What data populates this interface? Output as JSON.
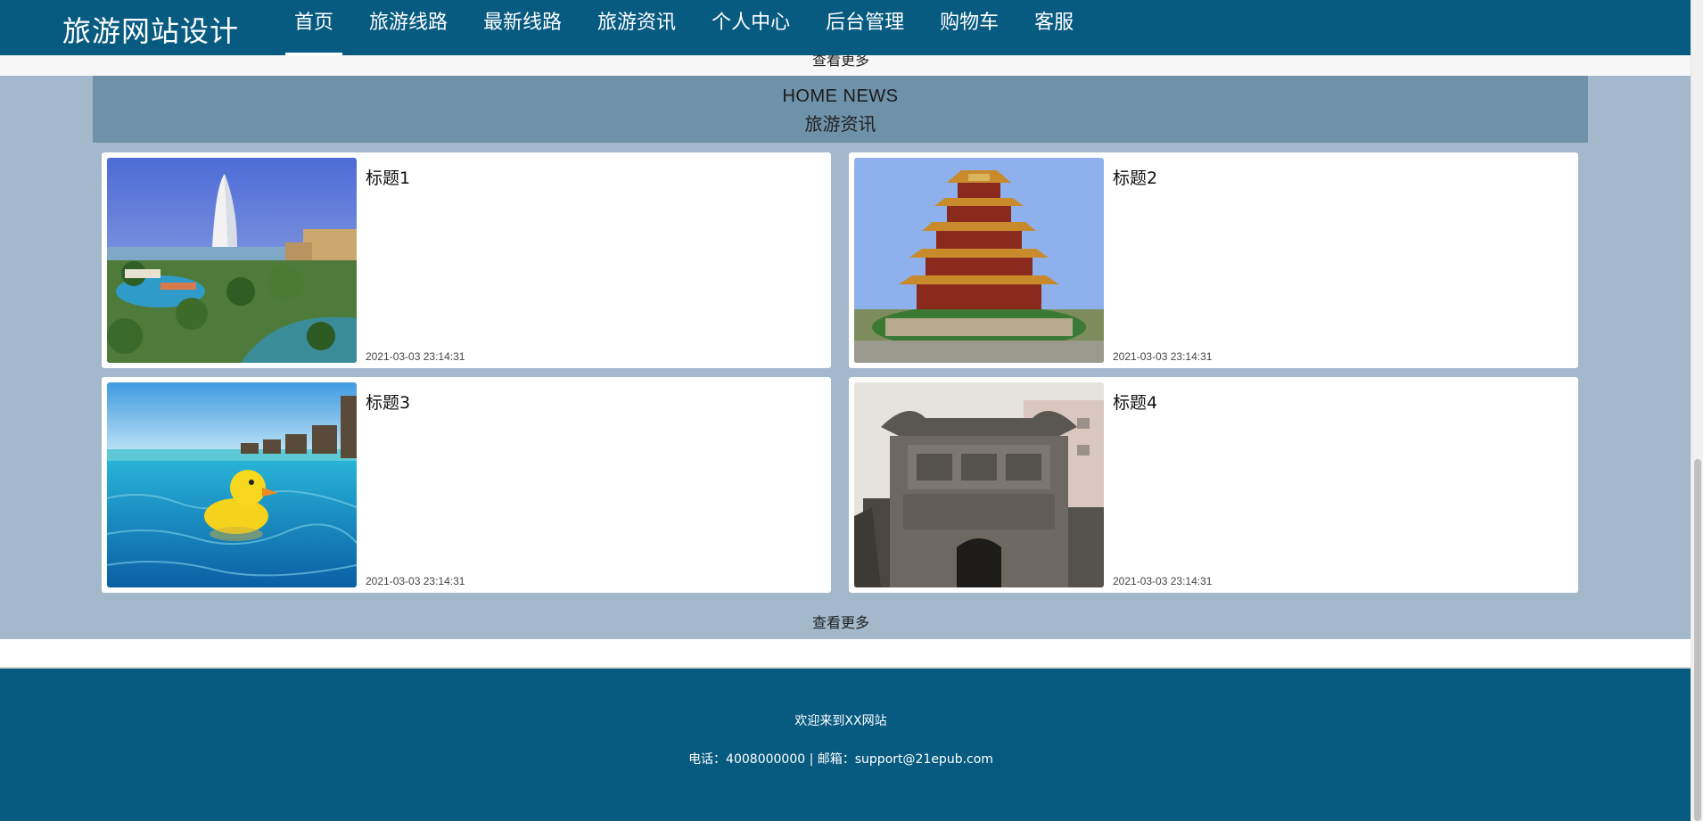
{
  "header": {
    "brand": "旅游网站设计",
    "nav": [
      {
        "label": "首页",
        "active": true
      },
      {
        "label": "旅游线路",
        "active": false
      },
      {
        "label": "最新线路",
        "active": false
      },
      {
        "label": "旅游资讯",
        "active": false
      },
      {
        "label": "个人中心",
        "active": false
      },
      {
        "label": "后台管理",
        "active": false
      },
      {
        "label": "购物车",
        "active": false
      },
      {
        "label": "客服",
        "active": false
      }
    ]
  },
  "upper_section": {
    "more_label": "查看更多"
  },
  "news": {
    "title_en": "HOME NEWS",
    "title_cn": "旅游资讯",
    "items": [
      {
        "title": "标题1",
        "date": "2021-03-03 23:14:31",
        "image": "burj-al-arab-resort-image"
      },
      {
        "title": "标题2",
        "date": "2021-03-03 23:14:31",
        "image": "yellow-crane-tower-image"
      },
      {
        "title": "标题3",
        "date": "2021-03-03 23:14:31",
        "image": "rubber-duck-pool-image"
      },
      {
        "title": "标题4",
        "date": "2021-03-03 23:14:31",
        "image": "ancient-stone-gate-image"
      }
    ],
    "more_label": "查看更多"
  },
  "footer": {
    "welcome": "欢迎来到XX网站",
    "contact": "电话：4008000000 | 邮箱：support@21epub.com"
  },
  "colors": {
    "primary": "#075a80",
    "section_bg": "#a3b8ca",
    "section_header_bg": "#6e92aa"
  }
}
